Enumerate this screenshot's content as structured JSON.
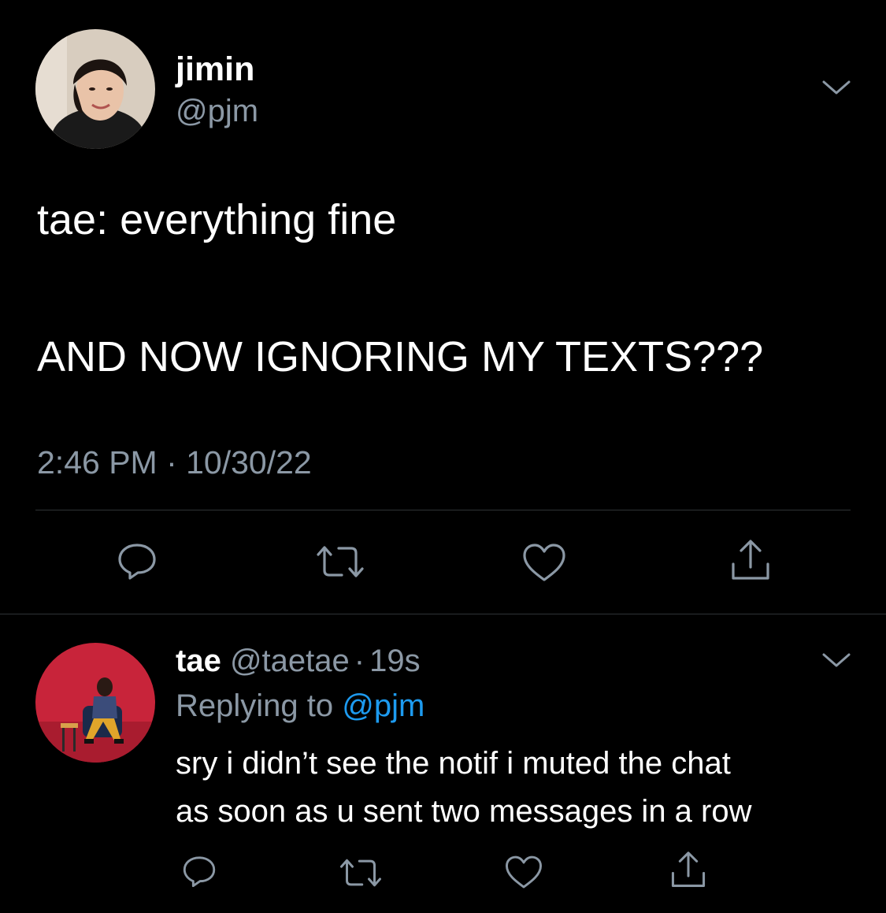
{
  "main_tweet": {
    "display_name": "jimin",
    "handle": "@pjm",
    "text_line1": "tae: everything fine",
    "text_line2": "AND NOW IGNORING MY TEXTS???",
    "timestamp": "2:46 PM · 10/30/22"
  },
  "reply": {
    "display_name": "tae",
    "handle": "@taetae",
    "separator": "·",
    "age": "19s",
    "replying_prefix": "Replying to",
    "replying_handle": "@pjm",
    "text_line1": "sry i didn’t see the notif i muted the chat",
    "text_line2": "as soon as u sent two messages in a row"
  },
  "actions": [
    "reply-icon",
    "retweet-icon",
    "like-icon",
    "share-icon"
  ],
  "colors": {
    "background": "#000000",
    "text": "#ffffff",
    "secondary": "#8b98a5",
    "link": "#1d9bf0",
    "divider": "#2f3336"
  }
}
